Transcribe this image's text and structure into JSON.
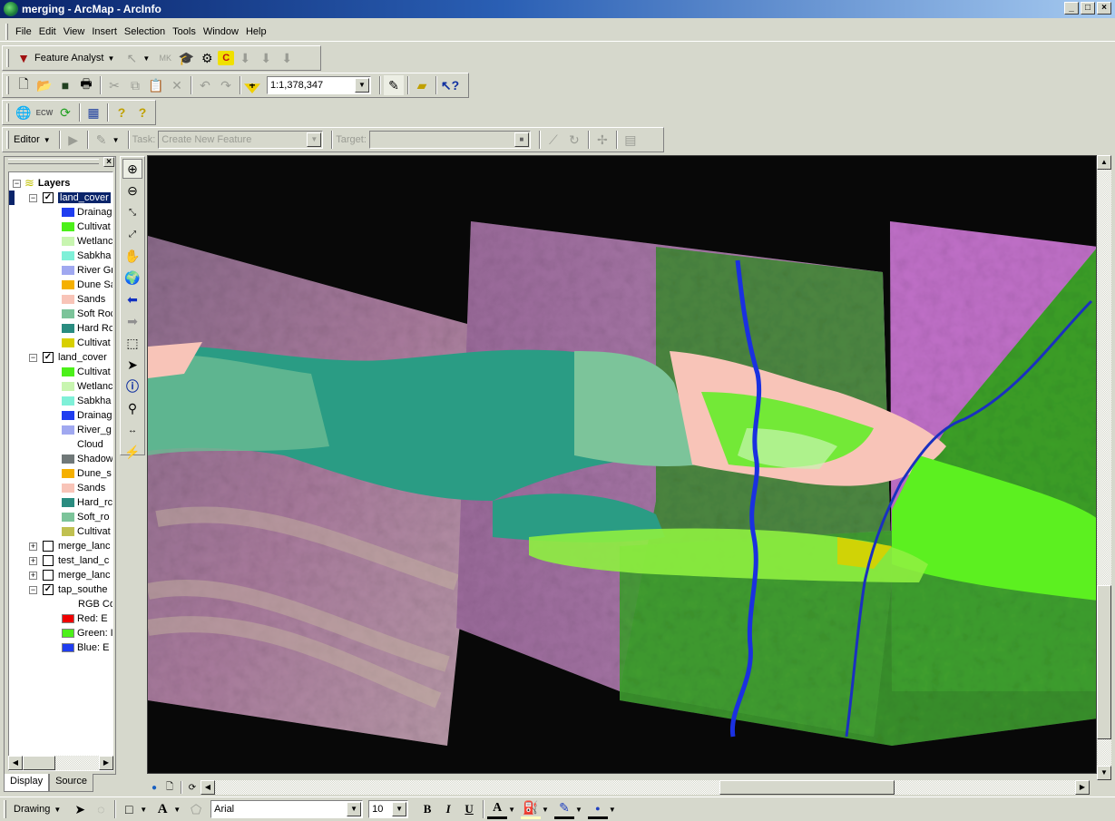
{
  "window": {
    "title": "merging - ArcMap - ArcInfo",
    "controls": [
      "_",
      "□",
      "×"
    ]
  },
  "menu": [
    {
      "label": "File",
      "key": "F"
    },
    {
      "label": "Edit",
      "key": "E"
    },
    {
      "label": "View",
      "key": "V"
    },
    {
      "label": "Insert",
      "key": "I"
    },
    {
      "label": "Selection",
      "key": "S"
    },
    {
      "label": "Tools",
      "key": "T"
    },
    {
      "label": "Window",
      "key": "W"
    },
    {
      "label": "Help",
      "key": "H"
    }
  ],
  "feature_analyst_toolbar": {
    "label": "Feature Analyst",
    "icons": [
      "feature-analyst-logo-icon",
      "select-feature-icon",
      "mk-icon",
      "learn-icon",
      "learn-2-icon",
      "clutter-icon",
      "down-arrow-1-icon",
      "down-arrow-2-icon",
      "down-arrow-3-icon"
    ]
  },
  "standard_toolbar": {
    "scale": "1:1,378,347",
    "icons": [
      "new-icon",
      "open-icon",
      "save-icon",
      "print-icon",
      "cut-icon",
      "copy-icon",
      "paste-icon",
      "delete-icon",
      "undo-icon",
      "redo-icon",
      "add-data-icon",
      "editor-toolbar-icon",
      "arctoolbox-icon",
      "whats-this-icon"
    ]
  },
  "ecw_toolbar": {
    "icons": [
      "globe-search-icon",
      "ecw-icon",
      "refresh-icon",
      "table-icon",
      "help-doc-icon",
      "help-icon"
    ]
  },
  "editor_toolbar": {
    "editor_label": "Editor",
    "task_label": "Task:",
    "task_value": "Create New Feature",
    "target_label": "Target:",
    "target_value": ""
  },
  "toc": {
    "root": "Layers",
    "tabs": [
      "Display",
      "Source"
    ],
    "items": [
      {
        "type": "layer",
        "label": "land_cover",
        "expanded": true,
        "checked": true,
        "selected": true
      },
      {
        "type": "class",
        "label": "Drainag",
        "color": "#1f3df0"
      },
      {
        "type": "class",
        "label": "Cultivat",
        "color": "#4cf01a"
      },
      {
        "type": "class",
        "label": "Wetlanc",
        "color": "#c8f5b0"
      },
      {
        "type": "class",
        "label": "Sabkha",
        "color": "#7ff0d8"
      },
      {
        "type": "class",
        "label": "River Gr",
        "color": "#a0a8f0"
      },
      {
        "type": "class",
        "label": "Dune Sa",
        "color": "#f5b000"
      },
      {
        "type": "class",
        "label": "Sands",
        "color": "#f8c4b8"
      },
      {
        "type": "class",
        "label": "Soft Roc",
        "color": "#7cc49a"
      },
      {
        "type": "class",
        "label": "Hard Rc",
        "color": "#2a8c80"
      },
      {
        "type": "class",
        "label": "Cultivat",
        "color": "#d8d000"
      },
      {
        "type": "layer",
        "label": "land_cover",
        "expanded": true,
        "checked": true,
        "selected": false
      },
      {
        "type": "class",
        "label": "Cultivat",
        "color": "#4cf01a"
      },
      {
        "type": "class",
        "label": "Wetlanc",
        "color": "#c8f5b0"
      },
      {
        "type": "class",
        "label": "Sabkha",
        "color": "#7ff0d8"
      },
      {
        "type": "class",
        "label": "Drainag",
        "color": "#1f3df0"
      },
      {
        "type": "class",
        "label": "River_g",
        "color": "#a0a8f0"
      },
      {
        "type": "class",
        "label": "Cloud",
        "color": ""
      },
      {
        "type": "class",
        "label": "Shadow",
        "color": "#707878"
      },
      {
        "type": "class",
        "label": "Dune_s",
        "color": "#f5b000"
      },
      {
        "type": "class",
        "label": "Sands",
        "color": "#f8c4b8"
      },
      {
        "type": "class",
        "label": "Hard_rc",
        "color": "#2a8c80"
      },
      {
        "type": "class",
        "label": "Soft_ro",
        "color": "#7cc49a"
      },
      {
        "type": "class",
        "label": "Cultivat",
        "color": "#c0c050"
      },
      {
        "type": "layer",
        "label": "merge_lanc",
        "expanded": false,
        "checked": false,
        "selected": false
      },
      {
        "type": "layer",
        "label": "test_land_c",
        "expanded": false,
        "checked": false,
        "selected": false
      },
      {
        "type": "layer",
        "label": "merge_lanc",
        "expanded": false,
        "checked": false,
        "selected": false
      },
      {
        "type": "layer",
        "label": "tap_southe",
        "expanded": true,
        "checked": true,
        "selected": false
      },
      {
        "type": "text",
        "label": "RGB Co"
      },
      {
        "type": "class",
        "label": "Red:   E",
        "color": "#f00000",
        "bordered": true
      },
      {
        "type": "class",
        "label": "Green: I",
        "color": "#4cf01a",
        "bordered": true
      },
      {
        "type": "class",
        "label": "Blue:   E",
        "color": "#1f3df0",
        "bordered": true
      }
    ]
  },
  "tools": [
    "zoom-in-icon",
    "zoom-out-icon",
    "fixed-zoom-in-icon",
    "fixed-zoom-out-icon",
    "pan-icon",
    "full-extent-icon",
    "back-extent-icon",
    "forward-extent-icon",
    "select-features-icon",
    "select-elements-icon",
    "identify-icon",
    "find-icon",
    "measure-icon",
    "hyperlink-icon"
  ],
  "drawing_toolbar": {
    "label": "Drawing",
    "font": "Arial",
    "size": "10",
    "bold": "B",
    "italic": "I",
    "underline": "U"
  },
  "colors": {
    "title_start": "#0a246a",
    "title_end": "#a6caf0",
    "chrome": "#d6d8cc",
    "map_bg": "#080808"
  }
}
